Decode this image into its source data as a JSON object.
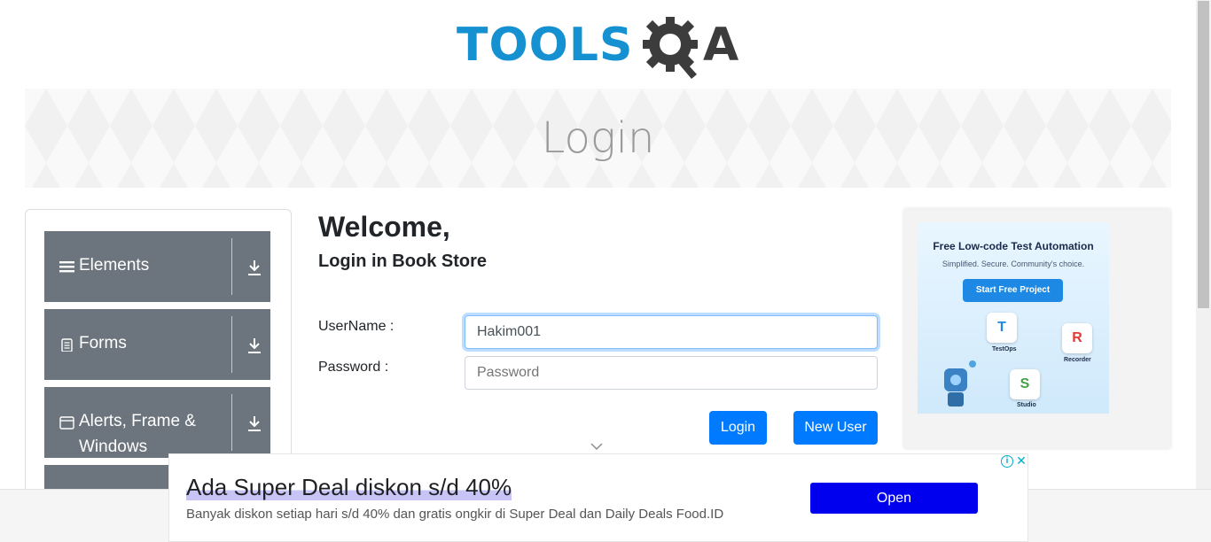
{
  "logo": {
    "part1": "TOOLS",
    "part2": "A"
  },
  "banner": {
    "title": "Login"
  },
  "sidebar": {
    "groups": [
      {
        "label": "Elements",
        "icon": "hamburger-icon"
      },
      {
        "label": "Forms",
        "icon": "document-icon"
      },
      {
        "label": "Alerts, Frame & Windows",
        "icon": "window-icon"
      }
    ]
  },
  "form": {
    "welcome": "Welcome,",
    "subtitle": "Login in Book Store",
    "username_label": "UserName :",
    "username_value": "Hakim001",
    "password_label": "Password :",
    "password_placeholder": "Password",
    "login_button": "Login",
    "new_user_button": "New User"
  },
  "ad_right": {
    "headline": "Free Low-code Test Automation",
    "tagline": "Simplified. Secure. Community's choice.",
    "cta": "Start Free Project",
    "tiles": [
      "TestOps",
      "Recorder",
      "Studio"
    ]
  },
  "ad_bottom": {
    "title": "Ada Super Deal diskon s/d 40%",
    "description": "Banyak diskon setiap hari s/d 40% dan gratis ongkir di Super Deal dan Daily Deals Food.ID",
    "button": "Open",
    "info_icon": "info-icon",
    "close_icon": "close-icon"
  },
  "colors": {
    "brand_blue": "#1591d2",
    "primary": "#007bff",
    "sidebar_bg": "#6c757d",
    "ad_open": "#0000ee"
  }
}
